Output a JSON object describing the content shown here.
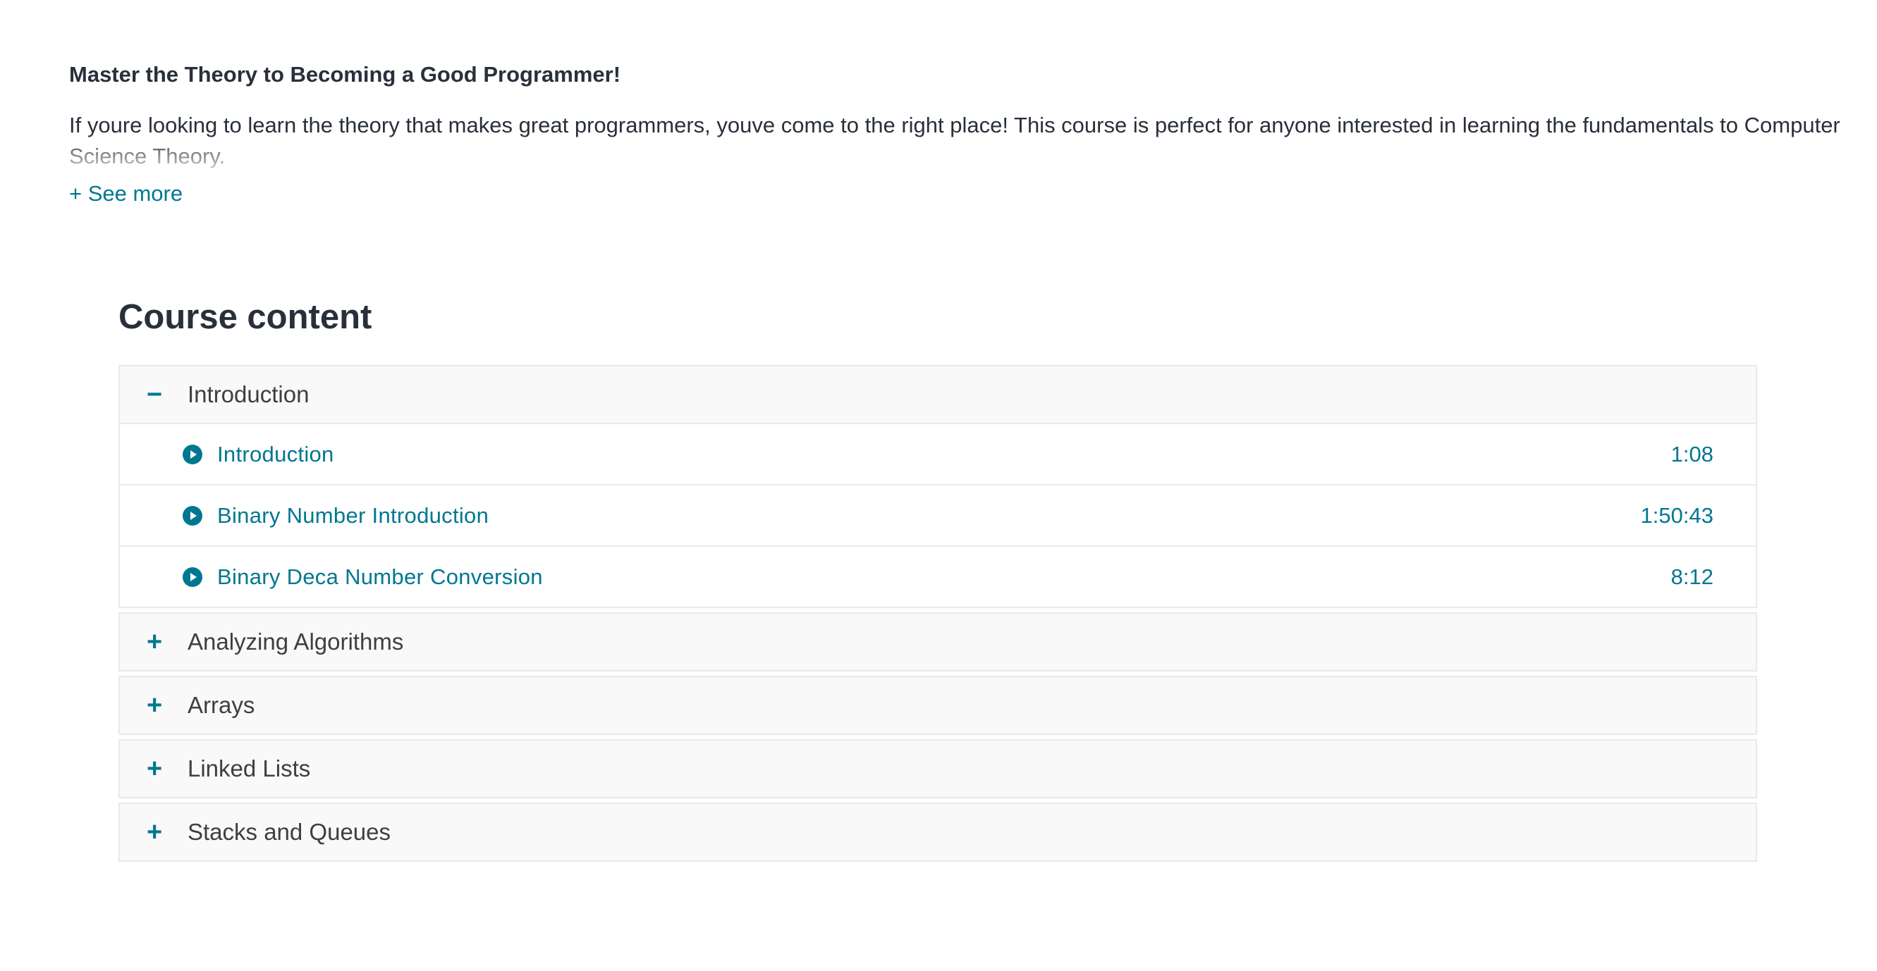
{
  "description": {
    "headline": "Master the Theory to Becoming a Good Programmer!",
    "body": "If youre looking to learn the theory that makes great programmers, youve come to the right place! This course is perfect for anyone interested in learning the fundamentals to Computer Science Theory.",
    "see_more_label": "+ See more"
  },
  "course_content": {
    "title": "Course content",
    "sections": [
      {
        "toggle": "−",
        "title": "Introduction",
        "expanded": true,
        "lectures": [
          {
            "title": "Introduction",
            "duration": "1:08",
            "icon": "play-circle-icon"
          },
          {
            "title": "Binary Number Introduction",
            "duration": "1:50:43",
            "icon": "play-circle-icon"
          },
          {
            "title": "Binary Deca Number Conversion",
            "duration": "8:12",
            "icon": "play-circle-icon"
          }
        ]
      },
      {
        "toggle": "+",
        "title": "Analyzing Algorithms",
        "expanded": false
      },
      {
        "toggle": "+",
        "title": "Arrays",
        "expanded": false
      },
      {
        "toggle": "+",
        "title": "Linked Lists",
        "expanded": false
      },
      {
        "toggle": "+",
        "title": "Stacks and Queues",
        "expanded": false
      }
    ]
  },
  "colors": {
    "accent": "#007791",
    "text": "#29303b",
    "section_bg": "#f9f9f9",
    "border": "#e8e9eb"
  }
}
